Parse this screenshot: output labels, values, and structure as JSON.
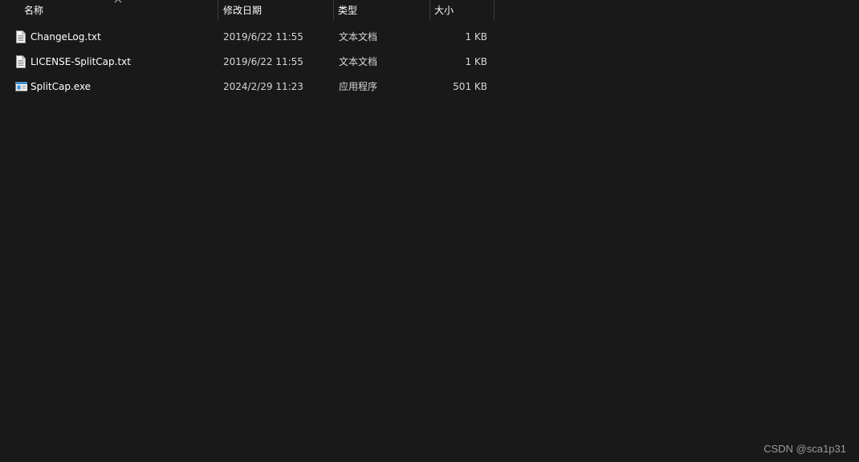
{
  "columns": {
    "name": "名称",
    "modified": "修改日期",
    "type": "类型",
    "size": "大小"
  },
  "files": [
    {
      "name": "ChangeLog.txt",
      "modified": "2019/6/22 11:55",
      "type": "文本文档",
      "size": "1 KB",
      "icon": "text-file-icon"
    },
    {
      "name": "LICENSE-SplitCap.txt",
      "modified": "2019/6/22 11:55",
      "type": "文本文档",
      "size": "1 KB",
      "icon": "text-file-icon"
    },
    {
      "name": "SplitCap.exe",
      "modified": "2024/2/29 11:23",
      "type": "应用程序",
      "size": "501 KB",
      "icon": "application-icon"
    }
  ],
  "watermark": "CSDN @sca1p31",
  "colors": {
    "background": "#191919",
    "text": "#ffffff",
    "divider": "#3a3a3a",
    "app_icon_blue": "#3a8fd6"
  }
}
